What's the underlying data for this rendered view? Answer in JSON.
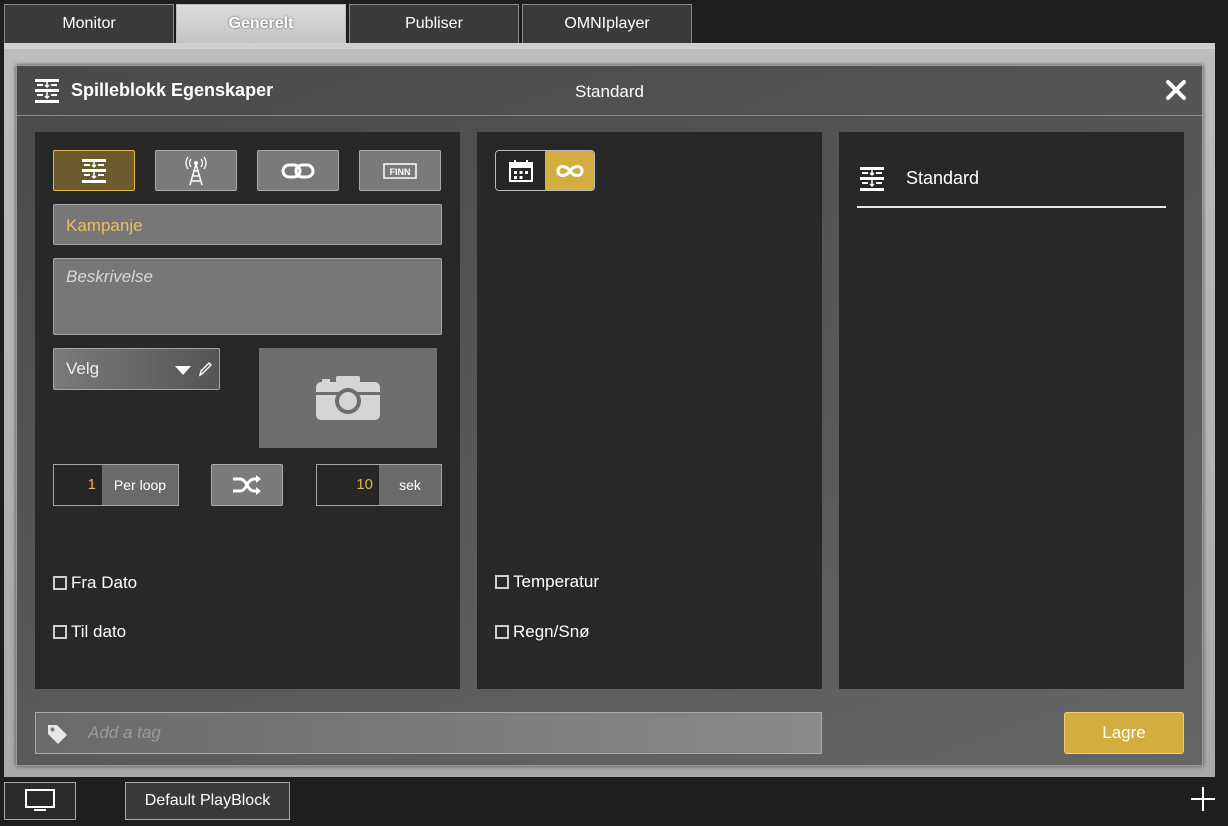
{
  "tabs": [
    {
      "label": "Monitor"
    },
    {
      "label": "Generelt"
    },
    {
      "label": "Publiser"
    },
    {
      "label": "OMNIplayer"
    }
  ],
  "dialog": {
    "title": "Spilleblokk Egenskaper",
    "subtitle": "Standard",
    "type_buttons": {
      "finn_label": "FINN"
    },
    "name_value": "Kampanje",
    "description_placeholder": "Beskrivelse",
    "select_value": "Velg",
    "count_value": "1",
    "count_unit": "Per loop",
    "duration_value": "10",
    "duration_unit": "sek",
    "left_checks": [
      "Fra Dato",
      "Til dato"
    ],
    "middle_checks": [
      "Temperatur",
      "Regn/Snø"
    ],
    "list": [
      {
        "label": "Standard"
      }
    ],
    "tag_placeholder": "Add a tag",
    "save_label": "Lagre"
  },
  "bottom": {
    "playblock_label": "Default PlayBlock"
  },
  "colors": {
    "accent": "#d4ad40",
    "accent_text": "#e8c15a"
  }
}
